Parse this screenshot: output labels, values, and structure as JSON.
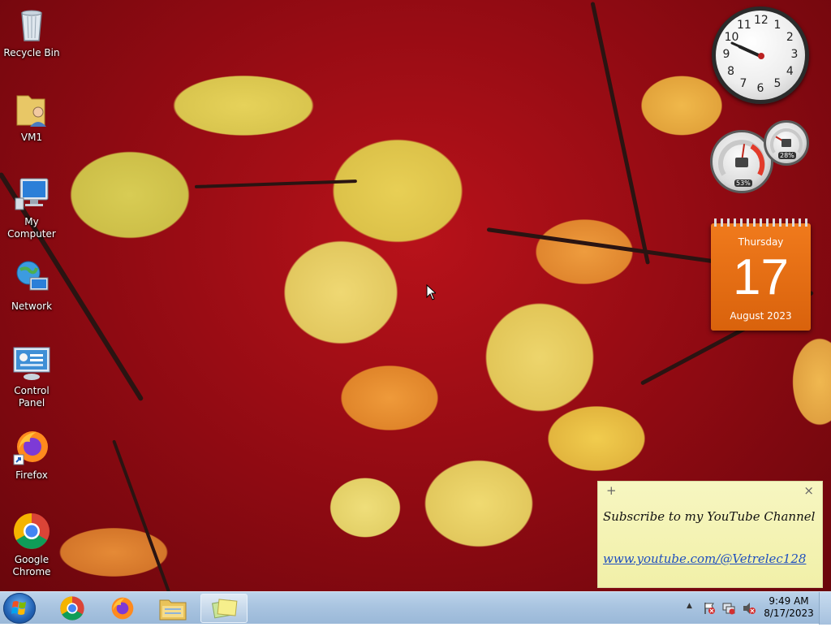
{
  "desktop": {
    "icons": [
      {
        "label": "Recycle Bin",
        "icon": "recycle-bin-icon"
      },
      {
        "label": "VM1",
        "icon": "user-folder-icon"
      },
      {
        "label": "My Computer",
        "icon": "computer-icon"
      },
      {
        "label": "Network",
        "icon": "network-icon"
      },
      {
        "label": "Control Panel",
        "icon": "control-panel-icon"
      },
      {
        "label": "Firefox",
        "icon": "firefox-icon"
      },
      {
        "label": "Google Chrome",
        "icon": "chrome-icon"
      }
    ]
  },
  "gadgets": {
    "clock": {
      "numbers": [
        "12",
        "1",
        "2",
        "3",
        "4",
        "5",
        "6",
        "7",
        "8",
        "9",
        "10",
        "11"
      ],
      "hour": 9,
      "minute": 49
    },
    "cpu_meter": {
      "cpu_value": "53%",
      "memory_value": "28%",
      "cpu_fraction": 0.53,
      "memory_fraction": 0.28
    },
    "calendar": {
      "weekday": "Thursday",
      "day": "17",
      "month_year": "August 2023"
    },
    "sticky_note": {
      "add_label": "+",
      "close_label": "×",
      "text": "Subscribe to my YouTube Channel",
      "link": "www.youtube.com/@Vetrelec128"
    }
  },
  "taskbar": {
    "pinned": [
      {
        "name": "chrome",
        "icon": "chrome-icon"
      },
      {
        "name": "firefox",
        "icon": "firefox-icon"
      },
      {
        "name": "explorer",
        "icon": "file-explorer-icon"
      },
      {
        "name": "sticky-notes",
        "icon": "sticky-notes-icon",
        "active": true
      }
    ],
    "tray": {
      "overflow_label": "▲",
      "time": "9:49 AM",
      "date": "8/17/2023"
    }
  },
  "colors": {
    "accent_orange": "#e56d12",
    "note_yellow": "#f5f4b8",
    "link_blue": "#1f4fbf",
    "taskbar_blue": "#a9c4e0"
  }
}
